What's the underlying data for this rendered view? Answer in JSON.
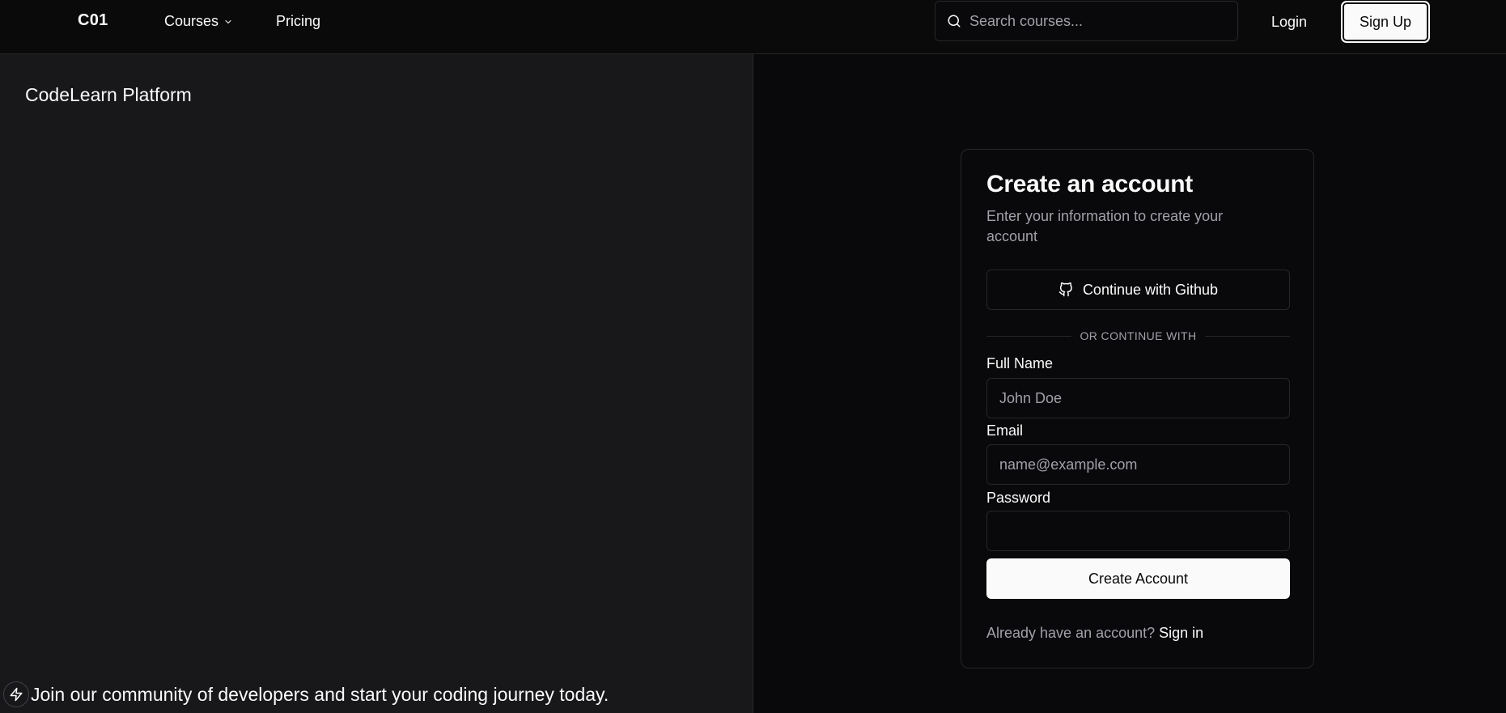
{
  "nav": {
    "logo": "C01",
    "courses_label": "Courses",
    "pricing_label": "Pricing",
    "search_placeholder": "Search courses...",
    "login_label": "Login",
    "signup_label": "Sign Up"
  },
  "left_panel": {
    "brand": "CodeLearn Platform",
    "tagline": "Join our community of developers and start your coding journey today."
  },
  "card": {
    "title": "Create an account",
    "subtitle": "Enter your information to create your account",
    "github_label": "Continue with Github",
    "divider_text": "OR CONTINUE WITH",
    "full_name": {
      "label": "Full Name",
      "placeholder": "John Doe",
      "value": ""
    },
    "email": {
      "label": "Email",
      "placeholder": "name@example.com",
      "value": ""
    },
    "password": {
      "label": "Password",
      "placeholder": "",
      "value": ""
    },
    "submit_label": "Create Account",
    "footer_prompt": "Already have an account?",
    "signin_label": "Sign in"
  },
  "colors": {
    "background": "#09090b",
    "panel": "#18181b",
    "border": "#27272a",
    "foreground": "#fafafa",
    "muted": "#a1a1aa"
  },
  "icons": [
    "search-icon",
    "chevron-down-icon",
    "github-icon",
    "zap-icon"
  ]
}
